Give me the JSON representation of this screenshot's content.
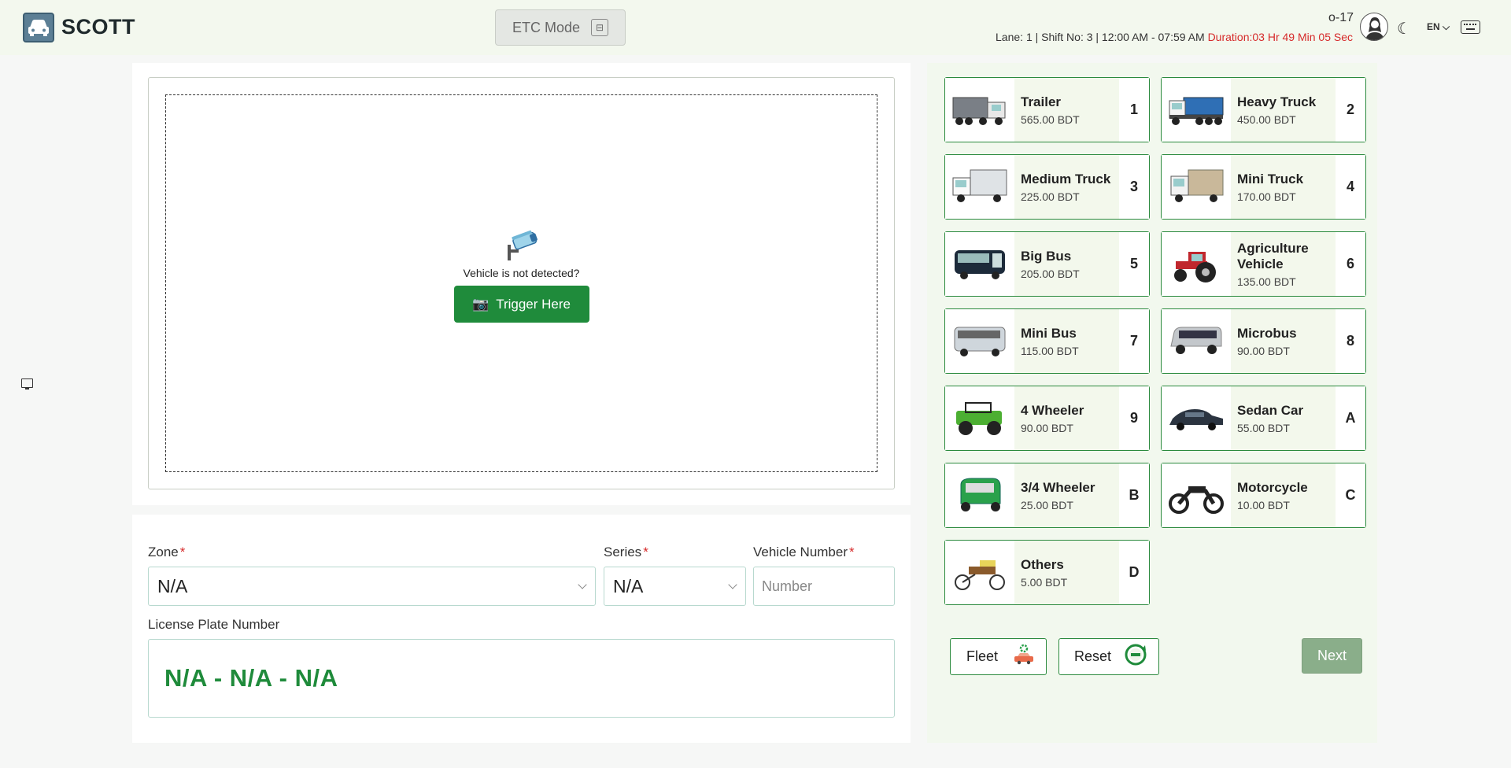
{
  "app": {
    "title": "SCOTT"
  },
  "header": {
    "etc_mode_label": "ETC Mode",
    "user_id": "o-17",
    "shift_info": "Lane: 1 |  Shift No: 3 | 12:00 AM - 07:59 AM",
    "duration": "Duration:03 Hr 49 Min 05 Sec",
    "language": "EN"
  },
  "camera": {
    "prompt": "Vehicle is not detected?",
    "trigger_label": "Trigger Here"
  },
  "form": {
    "zone_label": "Zone",
    "zone_value": "N/A",
    "series_label": "Series",
    "series_value": "N/A",
    "vehicle_number_label": "Vehicle Number",
    "vehicle_number_placeholder": "Number",
    "required_mark": "*",
    "plate_label": "License Plate Number",
    "plate_value": "N/A - N/A - N/A"
  },
  "vehicle_classes": [
    {
      "name": "Trailer",
      "price": "565.00 BDT",
      "key": "1",
      "icon": "trailer-icon",
      "color": "#7a7f86"
    },
    {
      "name": "Heavy Truck",
      "price": "450.00 BDT",
      "key": "2",
      "icon": "heavy-truck-icon",
      "color": "#2f6fb5"
    },
    {
      "name": "Medium Truck",
      "price": "225.00 BDT",
      "key": "3",
      "icon": "medium-truck-icon",
      "color": "#dfe3e6"
    },
    {
      "name": "Mini Truck",
      "price": "170.00 BDT",
      "key": "4",
      "icon": "mini-truck-icon",
      "color": "#c9b89a"
    },
    {
      "name": "Big Bus",
      "price": "205.00 BDT",
      "key": "5",
      "icon": "big-bus-icon",
      "color": "#1c2a3a"
    },
    {
      "name": "Agriculture Vehicle",
      "price": "135.00 BDT",
      "key": "6",
      "icon": "tractor-icon",
      "color": "#c0272d"
    },
    {
      "name": "Mini Bus",
      "price": "115.00 BDT",
      "key": "7",
      "icon": "mini-bus-icon",
      "color": "#cfd6dc"
    },
    {
      "name": "Microbus",
      "price": "90.00 BDT",
      "key": "8",
      "icon": "microbus-icon",
      "color": "#c3c7cb"
    },
    {
      "name": "4 Wheeler",
      "price": "90.00 BDT",
      "key": "9",
      "icon": "jeep-icon",
      "color": "#4caf32"
    },
    {
      "name": "Sedan Car",
      "price": "55.00 BDT",
      "key": "A",
      "icon": "sedan-icon",
      "color": "#2b3440"
    },
    {
      "name": "3/4 Wheeler",
      "price": "25.00 BDT",
      "key": "B",
      "icon": "cng-icon",
      "color": "#2aa14b"
    },
    {
      "name": "Motorcycle",
      "price": "10.00 BDT",
      "key": "C",
      "icon": "motorcycle-icon",
      "color": "#222222"
    },
    {
      "name": "Others",
      "price": "5.00 BDT",
      "key": "D",
      "icon": "rickshaw-icon",
      "color": "#8a5a2b"
    }
  ],
  "actions": {
    "fleet_label": "Fleet",
    "reset_label": "Reset",
    "next_label": "Next"
  },
  "colors": {
    "accent_green": "#1f8b3b",
    "border_green": "#2b8a3e",
    "duration_red": "#d62a2a"
  }
}
